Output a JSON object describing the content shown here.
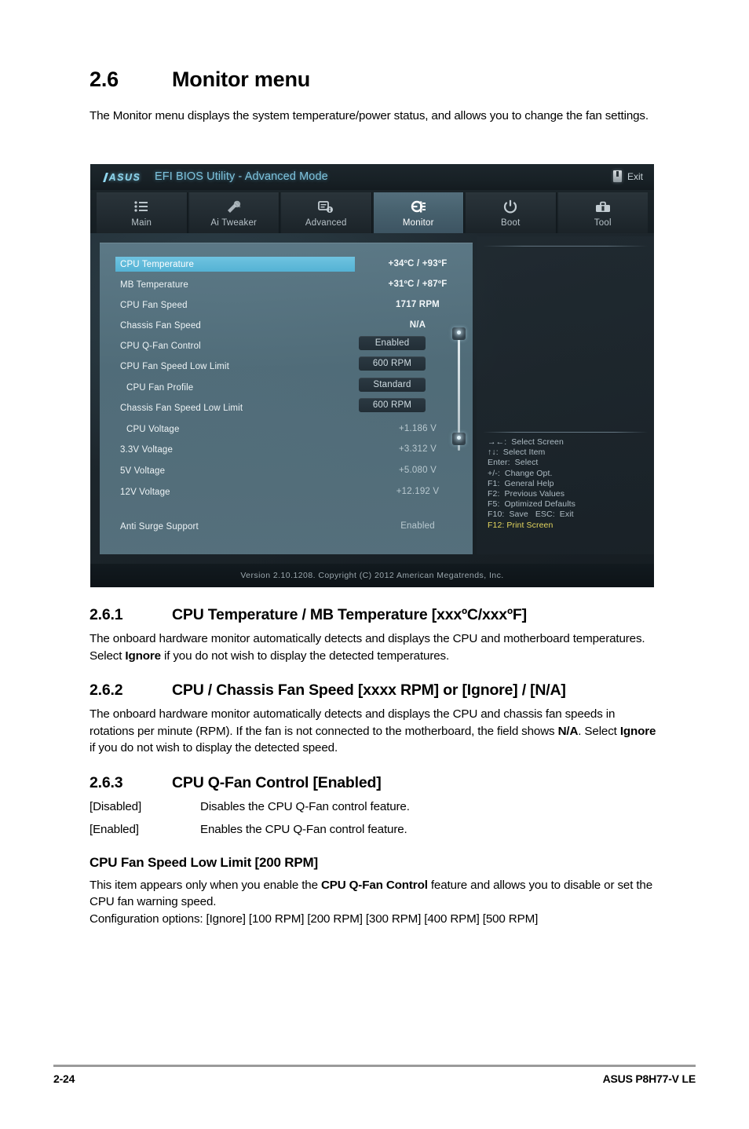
{
  "document": {
    "section": {
      "number": "2.6",
      "title": "Monitor menu",
      "intro": "The Monitor menu displays the system temperature/power status, and allows you to change the fan settings."
    },
    "sub_261": {
      "number": "2.6.1",
      "title": "CPU Temperature / MB Temperature [xxxºC/xxxºF]",
      "body_a": "The onboard hardware monitor automatically detects and displays the CPU and motherboard temperatures. Select ",
      "body_bold": "Ignore",
      "body_b": " if you do not wish to display the detected temperatures."
    },
    "sub_262": {
      "number": "2.6.2",
      "title": "CPU / Chassis Fan Speed [xxxx RPM] or [Ignore] / [N/A]",
      "body_a": "The onboard hardware monitor automatically detects and displays the CPU and chassis fan speeds in rotations per minute (RPM). If the fan is not connected to the motherboard, the field shows ",
      "body_bold1": "N/A",
      "body_b": ". Select ",
      "body_bold2": "Ignore",
      "body_c": " if you do not wish to display the detected speed."
    },
    "sub_263": {
      "number": "2.6.3",
      "title": "CPU Q-Fan Control [Enabled]",
      "options": [
        {
          "key": "[Disabled]",
          "desc": "Disables the CPU Q-Fan control feature."
        },
        {
          "key": "[Enabled]",
          "desc": "Enables the CPU Q-Fan control feature."
        }
      ]
    },
    "sub_low_limit": {
      "title": "CPU Fan Speed Low Limit [200 RPM]",
      "body_a": "This item appears only when you enable the ",
      "body_bold": "CPU Q-Fan Control",
      "body_b": " feature and allows you to disable or set the CPU fan warning speed.",
      "config_options": "Configuration options: [Ignore] [100 RPM] [200 RPM] [300 RPM] [400 RPM] [500 RPM]"
    },
    "footer": {
      "page_number": "2-24",
      "product": "ASUS P8H77-V LE"
    }
  },
  "bios": {
    "title": "EFI BIOS Utility - Advanced Mode",
    "logo": "ASUS",
    "exit_label": "Exit",
    "exit_icon": "exit-door-icon",
    "tabs": [
      {
        "label": "Main",
        "icon": "list-icon",
        "active": false
      },
      {
        "label": "Ai  Tweaker",
        "icon": "tweaker-icon",
        "active": false
      },
      {
        "label": "Advanced",
        "icon": "advanced-chip-icon",
        "active": false
      },
      {
        "label": "Monitor",
        "icon": "fan-monitor-icon",
        "active": true
      },
      {
        "label": "Boot",
        "icon": "power-icon",
        "active": false
      },
      {
        "label": "Tool",
        "icon": "toolbox-icon",
        "active": false
      }
    ],
    "rows": [
      {
        "label": "CPU Temperature",
        "value": "+34ºC / +93ºF",
        "style": "plain",
        "highlight": true,
        "indent": false
      },
      {
        "label": "MB Temperature",
        "value": "+31ºC / +87ºF",
        "style": "plain",
        "highlight": false,
        "indent": false
      },
      {
        "label": "CPU Fan Speed",
        "value": "1717 RPM",
        "style": "plain",
        "highlight": false,
        "indent": false
      },
      {
        "label": "Chassis Fan Speed",
        "value": "N/A",
        "style": "plain",
        "highlight": false,
        "indent": false
      },
      {
        "label": "CPU Q-Fan Control",
        "value": "Enabled",
        "style": "pill",
        "highlight": false,
        "indent": false
      },
      {
        "label": "CPU Fan Speed Low Limit",
        "value": "600 RPM",
        "style": "pill",
        "highlight": false,
        "indent": false
      },
      {
        "label": "CPU Fan Profile",
        "value": "Standard",
        "style": "pill",
        "highlight": false,
        "indent": true
      },
      {
        "label": "Chassis Fan Speed Low Limit",
        "value": "600 RPM",
        "style": "pill",
        "highlight": false,
        "indent": false
      },
      {
        "label": "CPU Voltage",
        "value": "+1.186 V",
        "style": "dim",
        "highlight": false,
        "indent": true
      },
      {
        "label": "3.3V Voltage",
        "value": "+3.312 V",
        "style": "dim",
        "highlight": false,
        "indent": false
      },
      {
        "label": "5V Voltage",
        "value": "+5.080 V",
        "style": "dim",
        "highlight": false,
        "indent": false
      },
      {
        "label": "12V Voltage",
        "value": "+12.192 V",
        "style": "dim",
        "highlight": false,
        "indent": false
      },
      {
        "label": "Anti Surge Support",
        "value": "Enabled",
        "style": "dim",
        "highlight": false,
        "indent": false
      }
    ],
    "help": [
      {
        "text": "→←:  Select Screen",
        "accent": false
      },
      {
        "text": "↑↓:  Select Item",
        "accent": false
      },
      {
        "text": "Enter:  Select",
        "accent": false
      },
      {
        "text": "+/-:  Change Opt.",
        "accent": false
      },
      {
        "text": "F1:  General Help",
        "accent": false
      },
      {
        "text": "F2:  Previous Values",
        "accent": false
      },
      {
        "text": "F5:  Optimized Defaults",
        "accent": false
      },
      {
        "text": "F10:  Save   ESC:  Exit",
        "accent": false
      },
      {
        "text": "F12: Print Screen",
        "accent": true
      }
    ],
    "version_line": "Version  2.10.1208.   Copyright  (C)  2012  American  Megatrends,  Inc.",
    "colors": {
      "highlight": "#54b2d4",
      "panel": "#5a7683",
      "accent_text": "#e3d55e",
      "title_text": "#7ec3dd"
    }
  }
}
